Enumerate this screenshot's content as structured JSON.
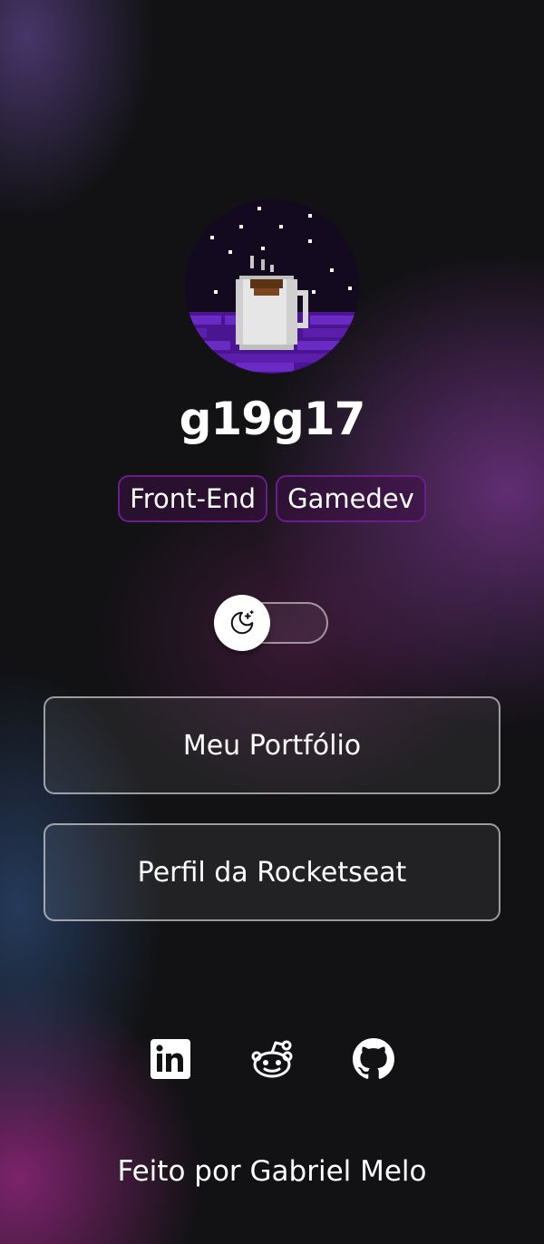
{
  "profile": {
    "username": "g19g17",
    "tags": [
      "Front-End",
      "Gamedev"
    ]
  },
  "theme_toggle": {
    "icon": "moon-stars-icon",
    "state": "dark"
  },
  "links": [
    {
      "label": "Meu Portfólio"
    },
    {
      "label": "Perfil da Rocketseat"
    }
  ],
  "social": [
    {
      "icon": "linkedin-icon"
    },
    {
      "icon": "reddit-icon"
    },
    {
      "icon": "github-icon"
    }
  ],
  "footer": {
    "prefix": "Feito por",
    "author": "Gabriel Melo"
  },
  "colors": {
    "background": "#121214",
    "tag_border": "#6a1f8c",
    "accent_purple": "#5b1fa0"
  }
}
